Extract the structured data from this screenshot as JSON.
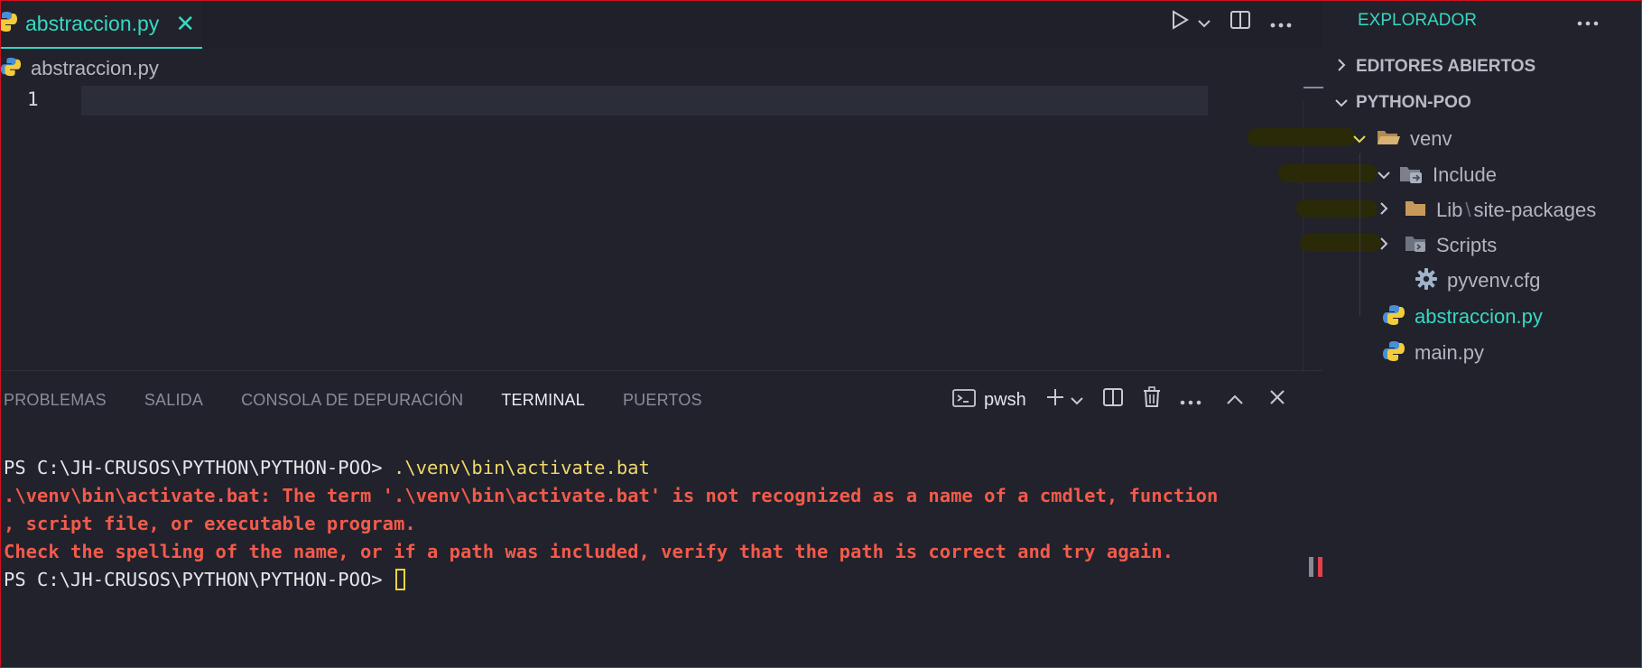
{
  "editor": {
    "tab": {
      "label": "abstraccion.py",
      "close_glyph": "✕"
    },
    "breadcrumb": "abstraccion.py",
    "line_number": "1",
    "actions": [
      "run-icon",
      "chevron-down-icon",
      "split-editor-icon",
      "more-icon"
    ]
  },
  "panel": {
    "tabs": [
      "PROBLEMAS",
      "SALIDA",
      "CONSOLA DE DEPURACIÓN",
      "TERMINAL",
      "PUERTOS"
    ],
    "active_tab": "TERMINAL",
    "shell": "pwsh",
    "terminal": {
      "prompt": "PS C:\\JH-CRUSOS\\PYTHON\\PYTHON-POO>",
      "command": ".\\venv\\bin\\activate.bat",
      "error_lines": [
        ".\\venv\\bin\\activate.bat: The term '.\\venv\\bin\\activate.bat' is not recognized as a name of a cmdlet, function",
        ", script file, or executable program.",
        "Check the spelling of the name, or if a path was included, verify that the path is correct and try again."
      ],
      "prompt2": "PS C:\\JH-CRUSOS\\PYTHON\\PYTHON-POO>"
    }
  },
  "explorer": {
    "title": "EXPLORADOR",
    "open_editors": "EDITORES ABIERTOS",
    "project": "PYTHON-POO",
    "tree": {
      "venv": "venv",
      "include": "Include",
      "lib": "Lib",
      "lib_sub": "site-packages",
      "scripts": "Scripts",
      "cfg": "pyvenv.cfg",
      "abstraccion": "abstraccion.py",
      "main": "main.py"
    }
  },
  "colors": {
    "accent": "#36d8c2",
    "error": "#f45a4a",
    "command": "#f0d86a",
    "background": "#21222c"
  }
}
